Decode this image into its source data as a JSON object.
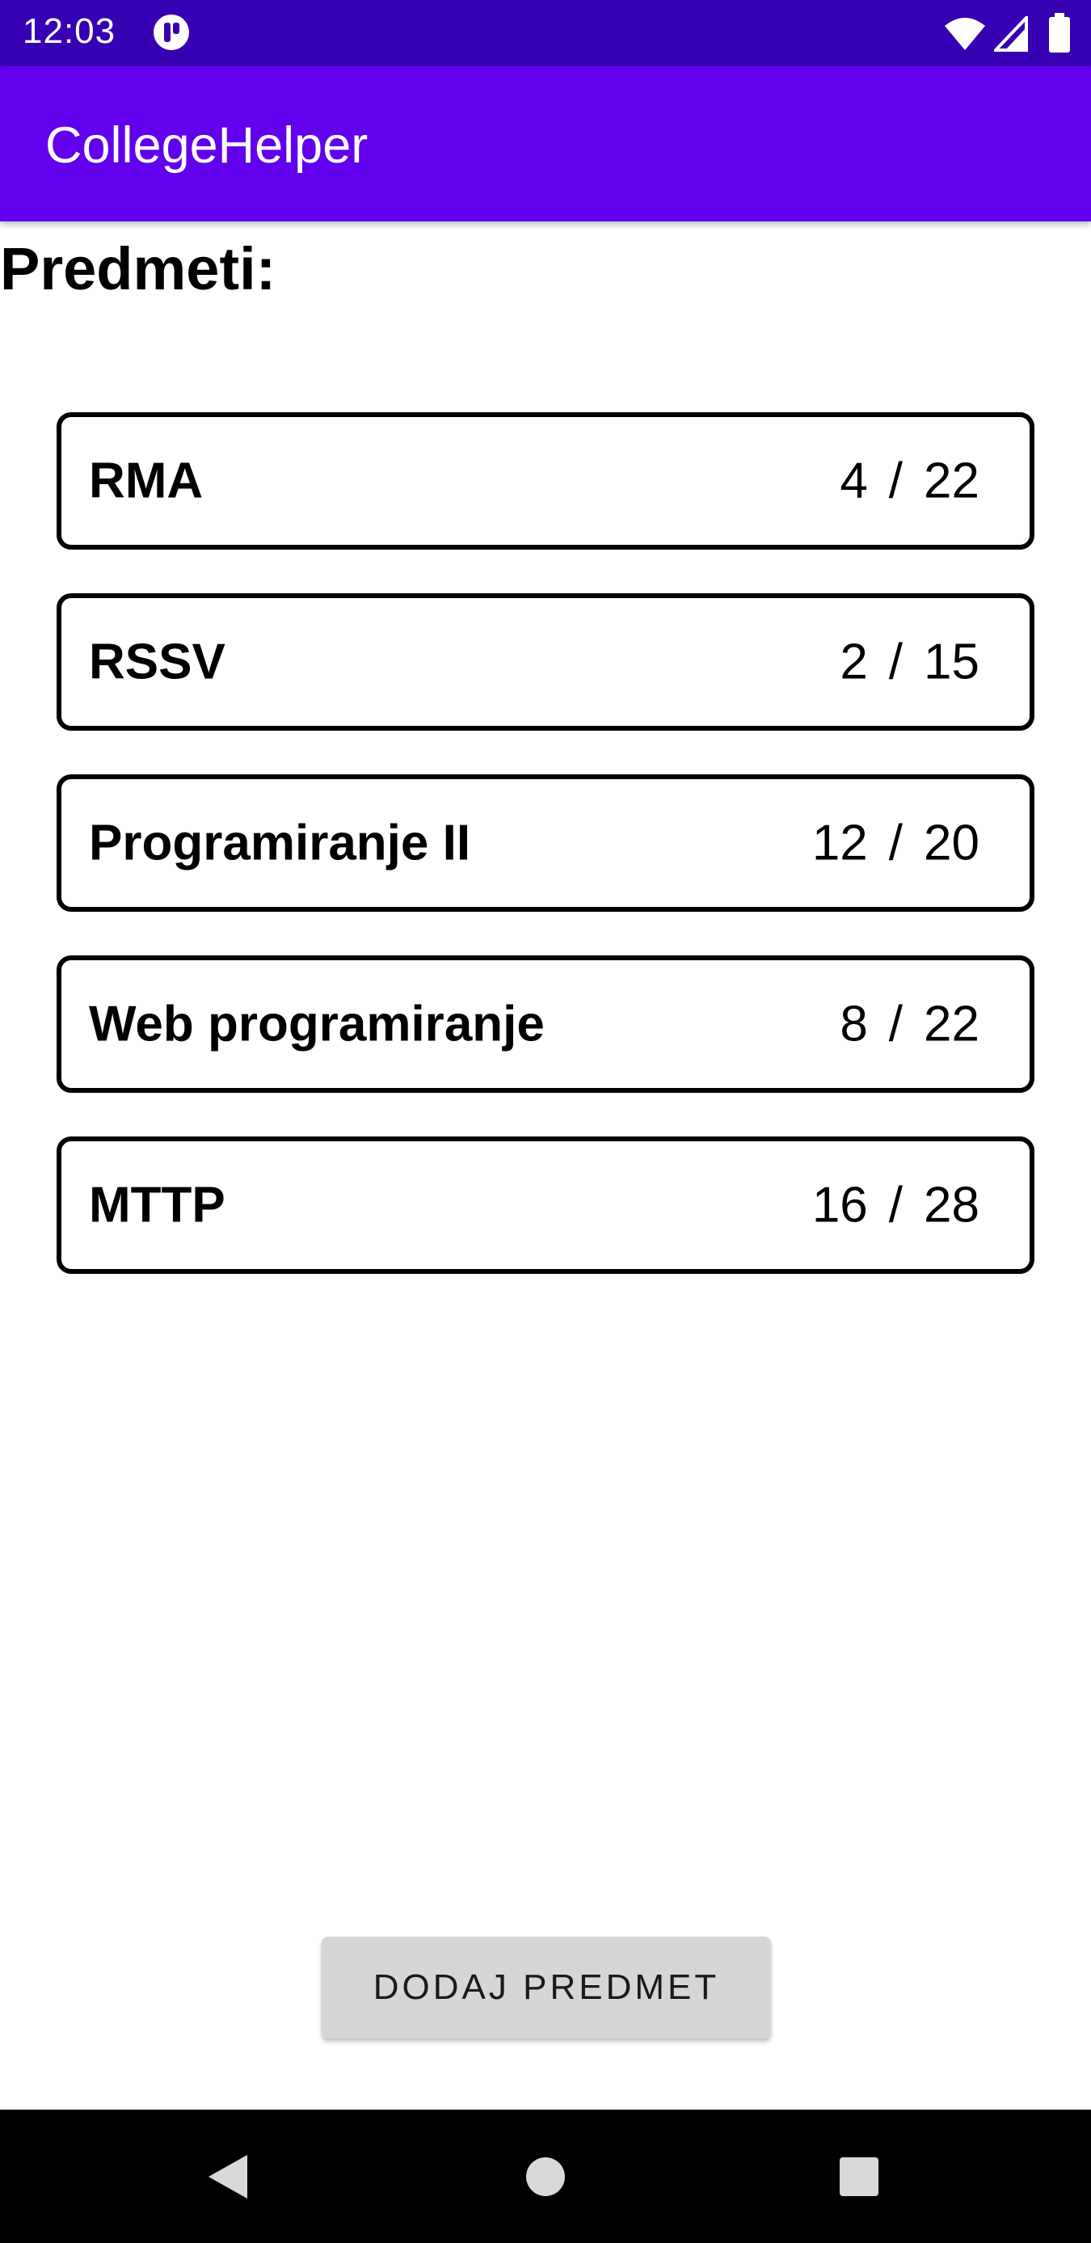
{
  "status_bar": {
    "time": "12:03",
    "icons": [
      "app-notification-icon",
      "wifi-icon",
      "signal-icon",
      "battery-icon"
    ]
  },
  "app_bar": {
    "title": "CollegeHelper",
    "color": "#6200EE"
  },
  "section": {
    "title": "Predmeti:"
  },
  "subjects": [
    {
      "name": "RMA",
      "completed": "4",
      "separator": "/",
      "total": "22"
    },
    {
      "name": "RSSV",
      "completed": "2",
      "separator": "/",
      "total": "15"
    },
    {
      "name": "Programiranje II",
      "completed": "12",
      "separator": "/",
      "total": "20"
    },
    {
      "name": "Web programiranje",
      "completed": "8",
      "separator": "/",
      "total": "22"
    },
    {
      "name": "MTTP",
      "completed": "16",
      "separator": "/",
      "total": "28"
    }
  ],
  "add_button": {
    "label": "DODAJ PREDMET"
  },
  "nav_bar": {
    "icons": [
      "back-icon",
      "home-icon",
      "recents-icon"
    ]
  },
  "colors": {
    "status_bar": "#3700B3",
    "app_bar": "#6200EE",
    "button": "#D6D6D6",
    "nav_bar": "#000000"
  }
}
